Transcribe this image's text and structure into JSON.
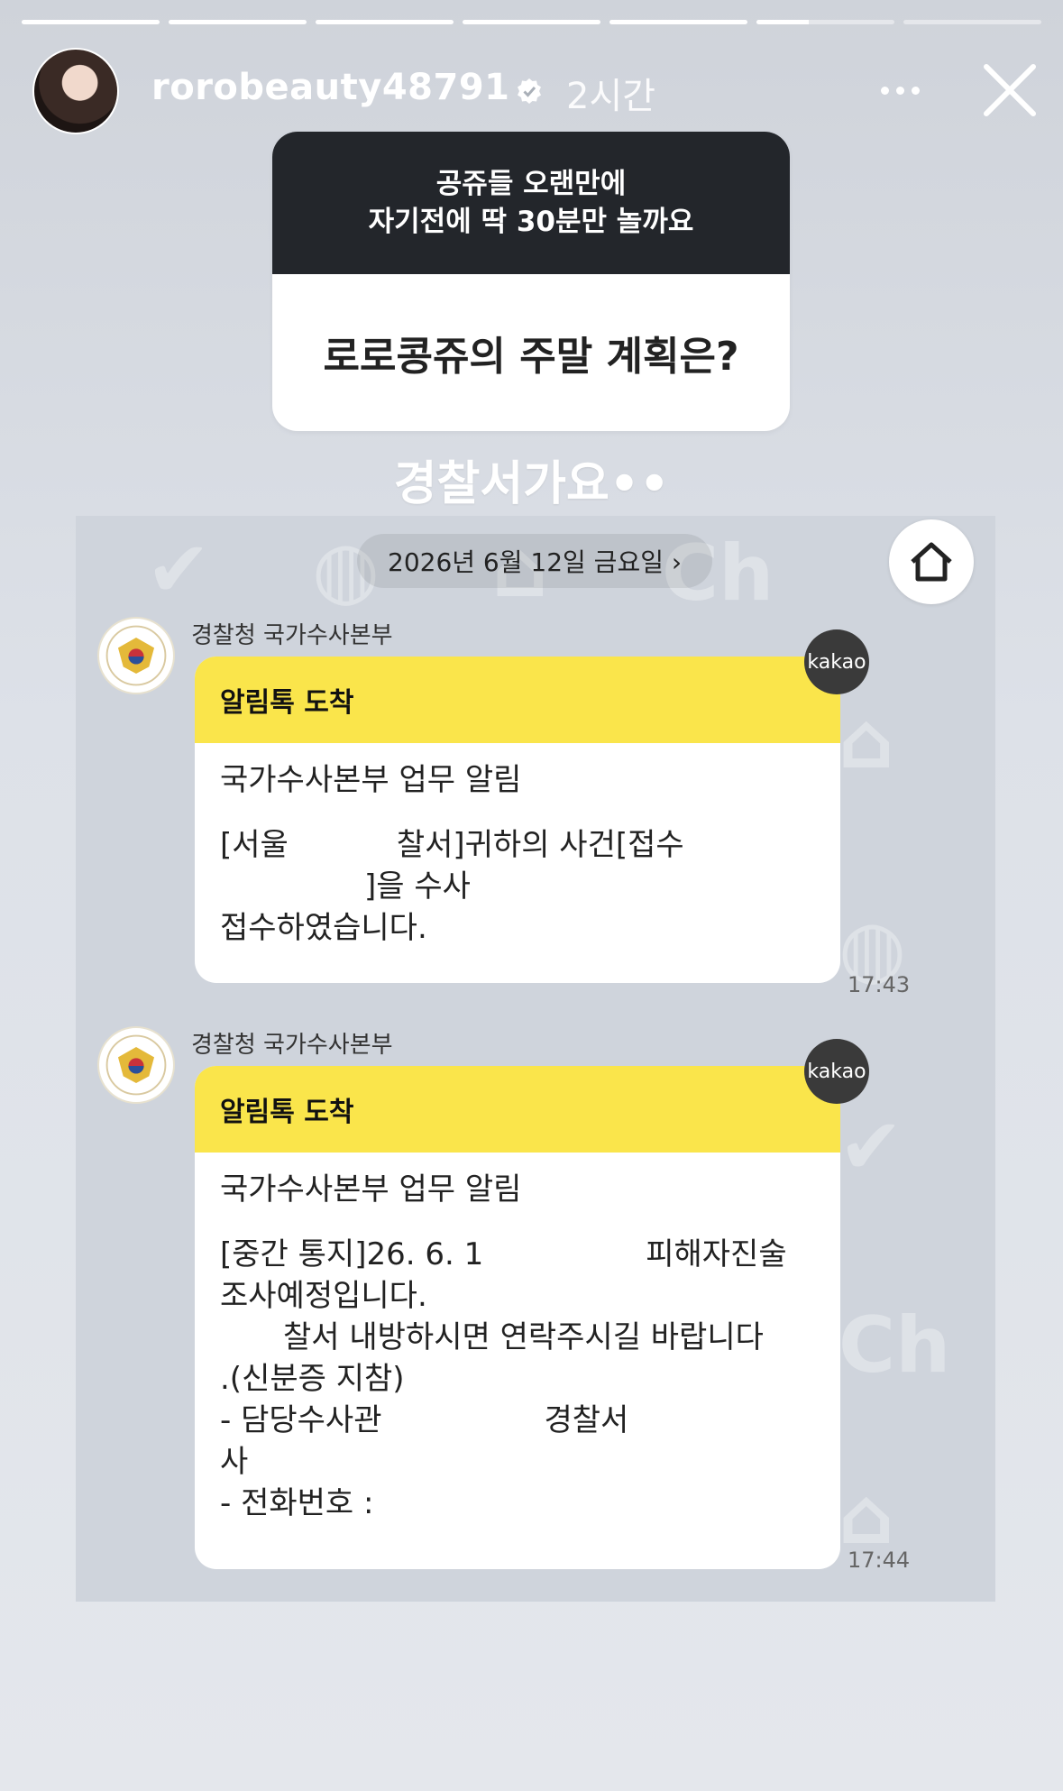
{
  "progress": {
    "segments": 7,
    "active_index": 5,
    "active_fill_fraction": 0.38
  },
  "header": {
    "username": "rorobeauty48791",
    "time": "2시간"
  },
  "question": {
    "prompt_line1": "공쥬들 오랜만에",
    "prompt_line2": "자기전에 딱 30분만 놀까요",
    "title": "로로콩쥬의 주말 계획은?"
  },
  "answer": "경찰서가요••",
  "chat": {
    "date": "2026년 6월 12일 금요일 ›",
    "messages": [
      {
        "sender": "경찰청 국가수사본부",
        "head": "알림톡 도착",
        "line1": "국가수사본부 업무 알림",
        "line2": "[서울",
        "line2b": "찰서]귀하의 사건[접수",
        "line3": "]을 수사",
        "line4": "접수하였습니다.",
        "kakao": "kakao",
        "time": "17:43"
      },
      {
        "sender": "경찰청 국가수사본부",
        "head": "알림톡 도착",
        "line1": "국가수사본부 업무 알림",
        "line2": "[중간 통지]26. 6. 1",
        "line2b": "피해자진술",
        "line3": "조사예정입니다.",
        "line4": "찰서 내방하시면 연락주시길 바랍니다",
        "line5": ".(신분증 지참)",
        "line6": "- 담당수사관",
        "line6b": "경찰서",
        "line7": "사",
        "line8": "- 전화번호 :",
        "kakao": "kakao",
        "time": "17:44"
      }
    ]
  }
}
